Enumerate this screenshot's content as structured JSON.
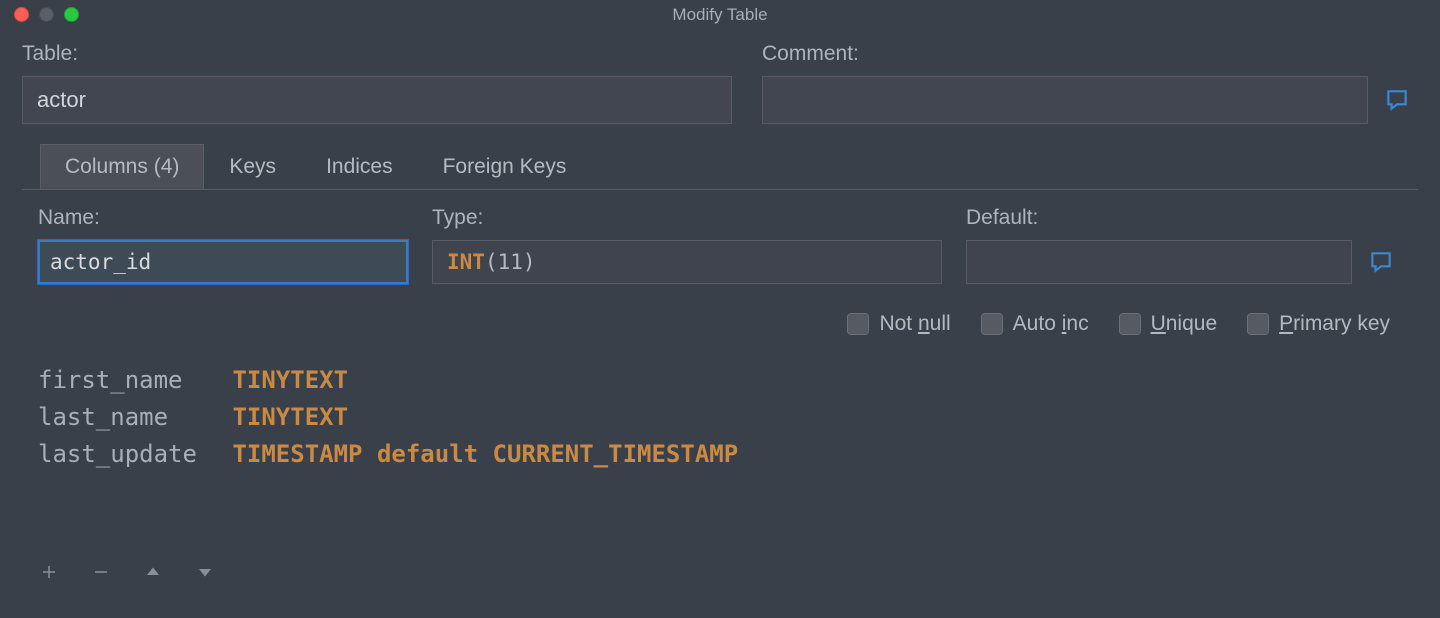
{
  "window": {
    "title": "Modify Table"
  },
  "top": {
    "table_label": "Table:",
    "table_value": "actor",
    "comment_label": "Comment:",
    "comment_value": ""
  },
  "tabs": {
    "columns": "Columns (4)",
    "keys": "Keys",
    "indices": "Indices",
    "foreign": "Foreign Keys"
  },
  "detail": {
    "name_label": "Name:",
    "name_value": "actor_id",
    "type_label": "Type:",
    "type_kw": "INT",
    "type_args": "(11)",
    "default_label": "Default:",
    "default_value": ""
  },
  "checks": {
    "notnull_pre": "Not ",
    "notnull_ul": "n",
    "notnull_post": "ull",
    "autoinc_pre": "Auto ",
    "autoinc_ul": "i",
    "autoinc_post": "nc",
    "unique_ul": "U",
    "unique_post": "nique",
    "primary_ul": "P",
    "primary_post": "rimary key"
  },
  "columns": [
    {
      "name": "first_name",
      "type": "TINYTEXT"
    },
    {
      "name": "last_name",
      "type": "TINYTEXT"
    },
    {
      "name": "last_update",
      "type": "TIMESTAMP default CURRENT_TIMESTAMP"
    }
  ]
}
